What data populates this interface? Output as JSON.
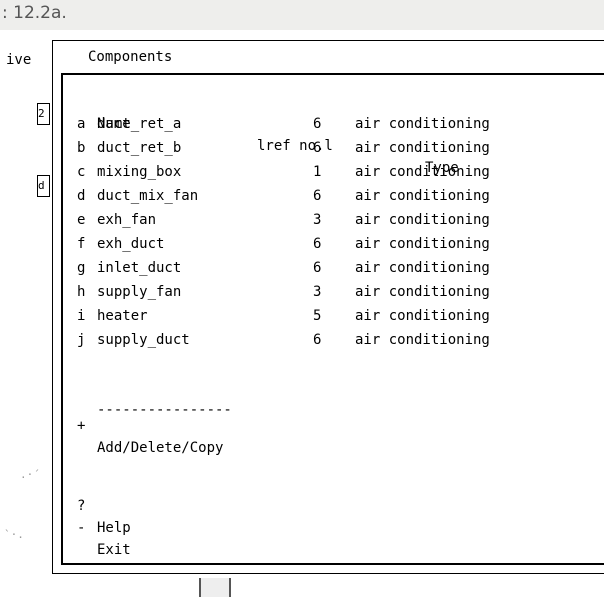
{
  "background": {
    "heading": ": 12.2a.",
    "side_word": "ive",
    "box1": "2",
    "box2": "d"
  },
  "dialog": {
    "title": "Components",
    "columns": {
      "name": "Name",
      "ref": "lref no.l",
      "type": "Type"
    },
    "rows": [
      {
        "key": "a",
        "name": "duct_ret_a",
        "ref": "6",
        "type": "air conditioning"
      },
      {
        "key": "b",
        "name": "duct_ret_b",
        "ref": "6",
        "type": "air conditioning"
      },
      {
        "key": "c",
        "name": "mixing_box",
        "ref": "1",
        "type": "air conditioning"
      },
      {
        "key": "d",
        "name": "duct_mix_fan",
        "ref": "6",
        "type": "air conditioning"
      },
      {
        "key": "e",
        "name": "exh_fan",
        "ref": "3",
        "type": "air conditioning"
      },
      {
        "key": "f",
        "name": "exh_duct",
        "ref": "6",
        "type": "air conditioning"
      },
      {
        "key": "g",
        "name": "inlet_duct",
        "ref": "6",
        "type": "air conditioning"
      },
      {
        "key": "h",
        "name": "supply_fan",
        "ref": "3",
        "type": "air conditioning"
      },
      {
        "key": "i",
        "name": "heater",
        "ref": "5",
        "type": "air conditioning"
      },
      {
        "key": "j",
        "name": "supply_duct",
        "ref": "6",
        "type": "air conditioning"
      }
    ],
    "separator": "----------------",
    "add": {
      "key": "+",
      "label": "Add/Delete/Copy"
    },
    "help": {
      "key": "?",
      "label": "Help"
    },
    "exit": {
      "key": "-",
      "label": "Exit"
    }
  }
}
